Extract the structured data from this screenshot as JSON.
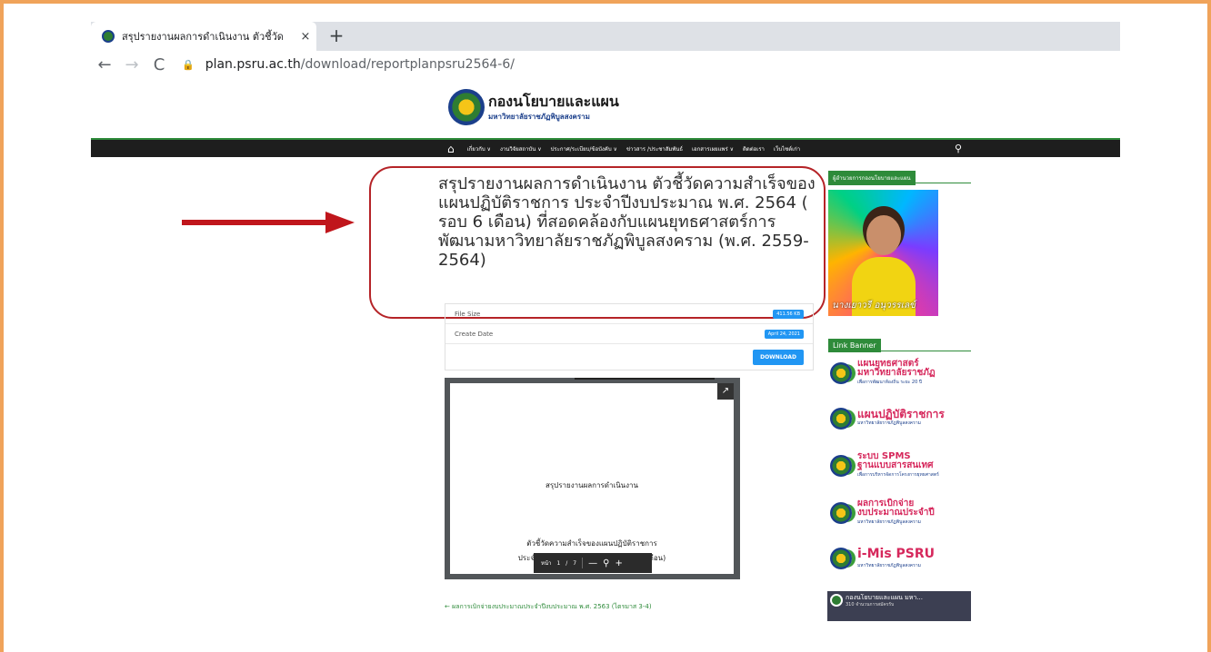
{
  "browser": {
    "tab_title": "สรุปรายงานผลการดำเนินงาน ตัวชี้วัด",
    "tab_close": "×",
    "new_tab": "+",
    "back": "←",
    "forward": "→",
    "reload": "C",
    "url_host": "plan.psru.ac.th",
    "url_path": "/download/reportplanpsru2564-6/"
  },
  "site": {
    "name": "กองนโยบายและแผน",
    "subtitle": "มหาวิทยาลัยราชภัฏพิบูลสงคราม",
    "nav": [
      "เกี่ยวกับ ∨",
      "งานวิจัยสถาบัน ∨",
      "ประกาศ/ระเบียบ/ข้อบังคับ ∨",
      "ข่าวสาร /ประชาสัมพันธ์",
      "เอกสารเผยแพร่ ∨",
      "ติดต่อเรา",
      "เว็บไซต์เก่า"
    ]
  },
  "post": {
    "title": "สรุปรายงานผลการดำเนินงาน ตัวชี้วัดความสำเร็จของแผนปฏิบัติราชการ ประจำปีงบประมาณ พ.ศ. 2564 ( รอบ 6 เดือน) ที่สอดคล้องกับแผนยุทธศาสตร์การพัฒนามหาวิทยาลัยราชภัฏพิบูลสงคราม (พ.ศ. 2559-2564)",
    "file_size_label": "File Size",
    "file_size_value": "411.56 KB",
    "create_date_label": "Create Date",
    "create_date_value": "April 24, 2021",
    "download_label": "DOWNLOAD",
    "pdf_line1": "สรุปรายงานผลการดำเนินงาน",
    "pdf_line2": "ตัวชี้วัดความสำเร็จของแผนปฏิบัติราชการ",
    "pdf_line3": "ประจำปีงบประมาณ พ.ศ. 2564 ( รอบ 6 เดือน)",
    "pdf_page_label": "หน้า",
    "pdf_page": "1",
    "pdf_page_sep": "/",
    "pdf_total": "7",
    "prev_post": "← ผลการเบิกจ่ายงบประมาณประจำปีงบประมาณ พ.ศ. 2563 (ไตรมาส 3-4)"
  },
  "sidebar": {
    "director_title": "ผู้อำนวยการกองนโยบายและแผน",
    "director_caption": "นางเยาวรี อนุวรรเลข์",
    "banner_title": "Link Banner",
    "banners": [
      {
        "line1": "แผนยุทธศาสตร์",
        "line2": "มหาวิทยาลัยราชภัฏ",
        "small": "เพื่อการพัฒนาท้องถิ่น ระยะ 20 ปี"
      },
      {
        "line1": "แผนปฏิบัติราชการ",
        "line2": "",
        "small": "มหาวิทยาลัยราชภัฏพิบูลสงคราม"
      },
      {
        "line1": "ระบบ SPMS",
        "line2": "ฐานแบบสารสนเทศ",
        "small": "เพื่อการบริหารจัดการโครงการยุทธศาสตร์"
      },
      {
        "line1": "ผลการเบิกจ่าย",
        "line2": "งบประมาณประจำปี",
        "small": "มหาวิทยาลัยราชภัฏพิบูลสงคราม"
      },
      {
        "line1": "i-Mis PSRU",
        "line2": "",
        "small": "มหาวิทยาลัยราชภัฏพิบูลสงคราม"
      }
    ],
    "video_title": "กองนโยบายและแผน มหา...",
    "video_sub": "310 จำนวนการสมัครรับ"
  },
  "colors": {
    "accent": "#2e8b3a",
    "highlight": "#b52327",
    "button": "#2196f3",
    "frame": "#f0a35a"
  }
}
